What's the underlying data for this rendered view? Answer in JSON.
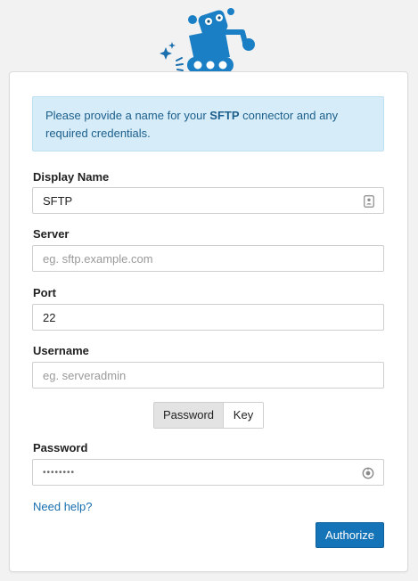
{
  "info": {
    "prefix": "Please provide a name for your ",
    "connector": "SFTP",
    "suffix": " connector and any required credentials."
  },
  "fields": {
    "display_name": {
      "label": "Display Name",
      "value": "SFTP"
    },
    "server": {
      "label": "Server",
      "placeholder": "eg. sftp.example.com"
    },
    "port": {
      "label": "Port",
      "value": "22"
    },
    "username": {
      "label": "Username",
      "placeholder": "eg. serveradmin"
    },
    "password": {
      "label": "Password",
      "value": "••••••••"
    }
  },
  "auth_toggle": {
    "password": "Password",
    "key": "Key",
    "selected": "Password"
  },
  "help_link": "Need help?",
  "authorize_button": "Authorize",
  "colors": {
    "accent": "#1573b8",
    "info_bg": "#d6ecf8",
    "info_text": "#1c5f8c",
    "link": "#1a6faf"
  }
}
